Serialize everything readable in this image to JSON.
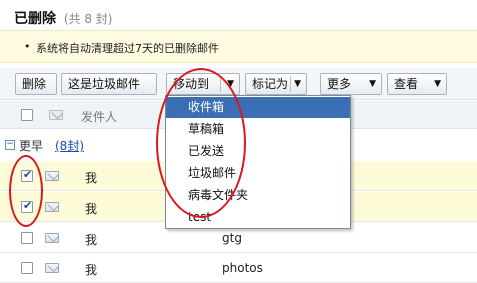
{
  "title": "已删除",
  "count_text": "(共 8 封)",
  "notice": {
    "bullet": "•",
    "text": "系统将自动清理超过7天的已删除邮件"
  },
  "toolbar": {
    "delete_label": "删除",
    "spam_label": "这是垃圾邮件",
    "move_label": "移动到",
    "mark_label": "标记为",
    "more_label": "更多",
    "view_label": "查看",
    "arrow": "▼"
  },
  "list_header": {
    "sender_label": "发件人"
  },
  "group": {
    "toggle": "−",
    "label": "更早",
    "count": "(8封)"
  },
  "rows": [
    {
      "checked": true,
      "sender": "我",
      "subject": ""
    },
    {
      "checked": true,
      "sender": "我",
      "subject": ""
    },
    {
      "checked": false,
      "sender": "我",
      "subject": "gtg"
    },
    {
      "checked": false,
      "sender": "我",
      "subject": "photos"
    }
  ],
  "move_menu": {
    "items": [
      "收件箱",
      "草稿箱",
      "已发送",
      "垃圾邮件",
      "病毒文件夹",
      "test"
    ],
    "active_index": 0
  },
  "colors": {
    "annotation_red": "#d9191c",
    "menu_highlight": "#3a6fb6",
    "selected_row": "#fdfbd8",
    "notice_bg": "#fffbe0"
  }
}
